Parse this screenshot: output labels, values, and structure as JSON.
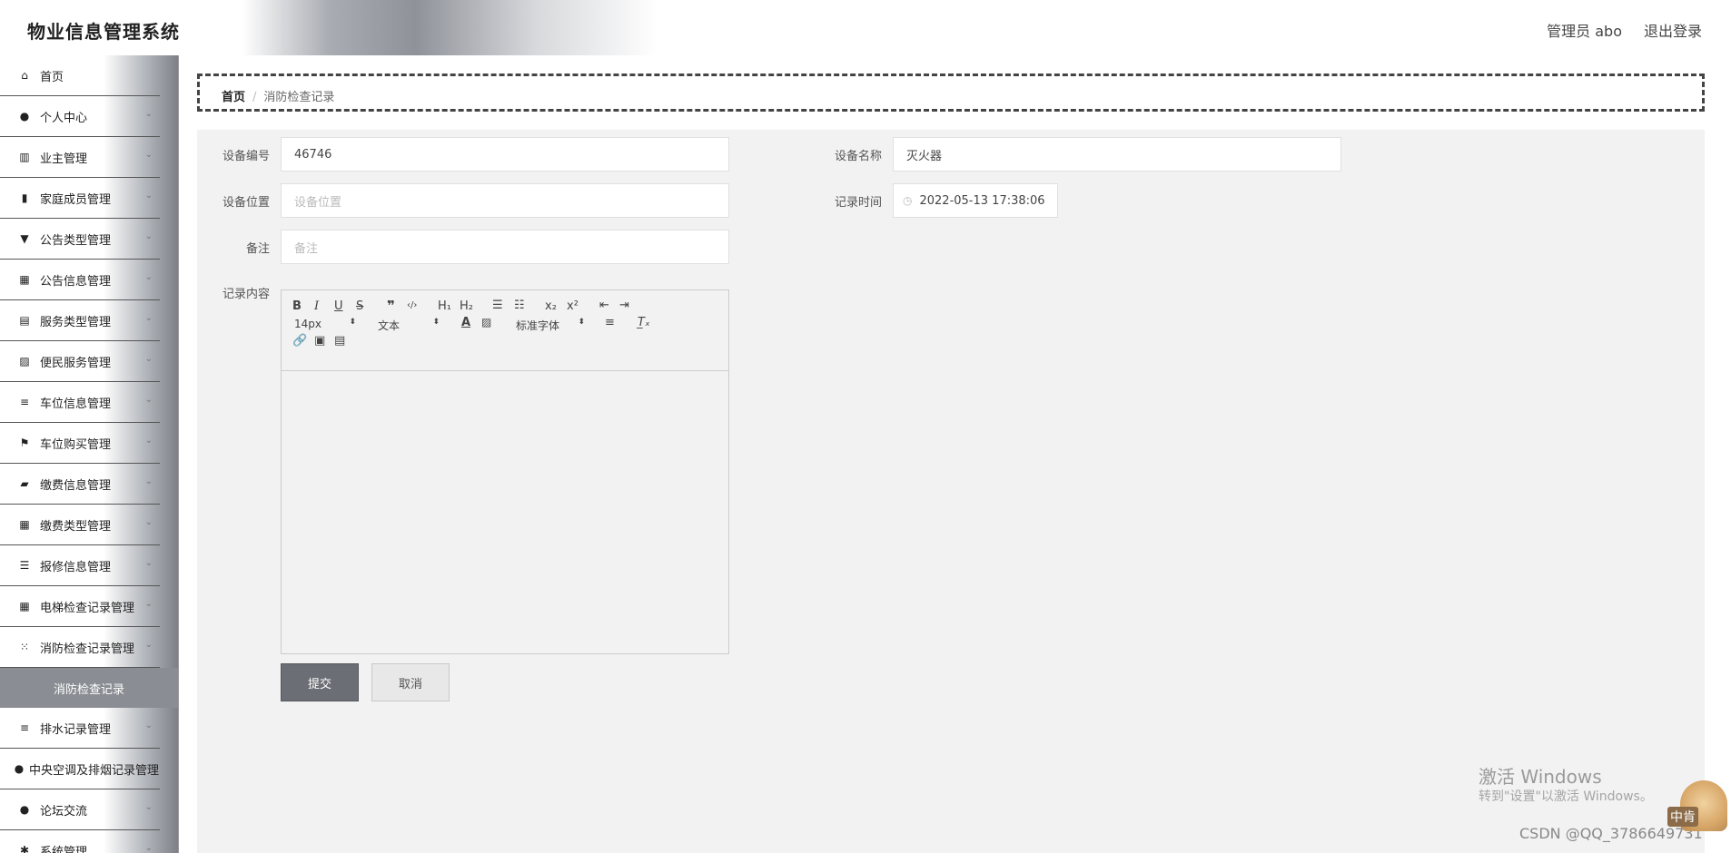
{
  "header": {
    "title": "物业信息管理系统",
    "admin": "管理员 abo",
    "logout": "退出登录"
  },
  "sidebar": {
    "items": [
      {
        "label": "首页",
        "icon": "home-icon",
        "glyph": "⌂"
      },
      {
        "label": "个人中心",
        "icon": "user-icon",
        "glyph": "●"
      },
      {
        "label": "业主管理",
        "icon": "library-icon",
        "glyph": "▥"
      },
      {
        "label": "家庭成员管理",
        "icon": "bar-chart-icon",
        "glyph": "▮"
      },
      {
        "label": "公告类型管理",
        "icon": "brush-icon",
        "glyph": "▼"
      },
      {
        "label": "公告信息管理",
        "icon": "grid-icon",
        "glyph": "▦"
      },
      {
        "label": "服务类型管理",
        "icon": "clipboard-icon",
        "glyph": "▤"
      },
      {
        "label": "便民服务管理",
        "icon": "line-chart-icon",
        "glyph": "▨"
      },
      {
        "label": "车位信息管理",
        "icon": "list-icon",
        "glyph": "≡"
      },
      {
        "label": "车位购买管理",
        "icon": "flag-icon",
        "glyph": "⚑"
      },
      {
        "label": "缴费信息管理",
        "icon": "ticket-icon",
        "glyph": "▰"
      },
      {
        "label": "缴费类型管理",
        "icon": "grid-icon",
        "glyph": "▦"
      },
      {
        "label": "报修信息管理",
        "icon": "sliders-icon",
        "glyph": "☰"
      },
      {
        "label": "电梯检查记录管理",
        "icon": "grid-icon",
        "glyph": "▦"
      },
      {
        "label": "消防检查记录管理",
        "icon": "apps-icon",
        "glyph": "⁙"
      },
      {
        "label": "消防检查记录",
        "icon": "",
        "glyph": "",
        "sub": true
      },
      {
        "label": "排水记录管理",
        "icon": "list-icon",
        "glyph": "≡"
      },
      {
        "label": "中央空调及排烟记录管理",
        "icon": "location-icon",
        "glyph": "●"
      },
      {
        "label": "论坛交流",
        "icon": "user-icon",
        "glyph": "●"
      },
      {
        "label": "系统管理",
        "icon": "settings-icon",
        "glyph": "✱"
      }
    ]
  },
  "breadcrumb": {
    "home": "首页",
    "sep": "/",
    "current": "消防检查记录"
  },
  "form": {
    "device_no_label": "设备编号",
    "device_no_value": "46746",
    "device_name_label": "设备名称",
    "device_name_value": "灭火器",
    "location_label": "设备位置",
    "location_placeholder": "设备位置",
    "time_label": "记录时间",
    "time_value": "2022-05-13 17:38:06",
    "remark_label": "备注",
    "remark_placeholder": "备注",
    "content_label": "记录内容"
  },
  "editor": {
    "font_size": "14px",
    "header_select": "文本",
    "font_family": "标准字体",
    "bold": "B",
    "italic": "I",
    "underline": "U",
    "strike": "S",
    "quote": "❞",
    "code": "‹/›",
    "h1": "H₁",
    "h2": "H₂",
    "sub": "x₂",
    "sup": "x²",
    "clean": "T̲ₓ"
  },
  "buttons": {
    "submit": "提交",
    "cancel": "取消"
  },
  "overlay": {
    "windows_title": "激活 Windows",
    "windows_sub": "转到\"设置\"以激活 Windows。",
    "watermark": "CSDN @QQ_3786649731",
    "mascot_text": "中肯"
  }
}
